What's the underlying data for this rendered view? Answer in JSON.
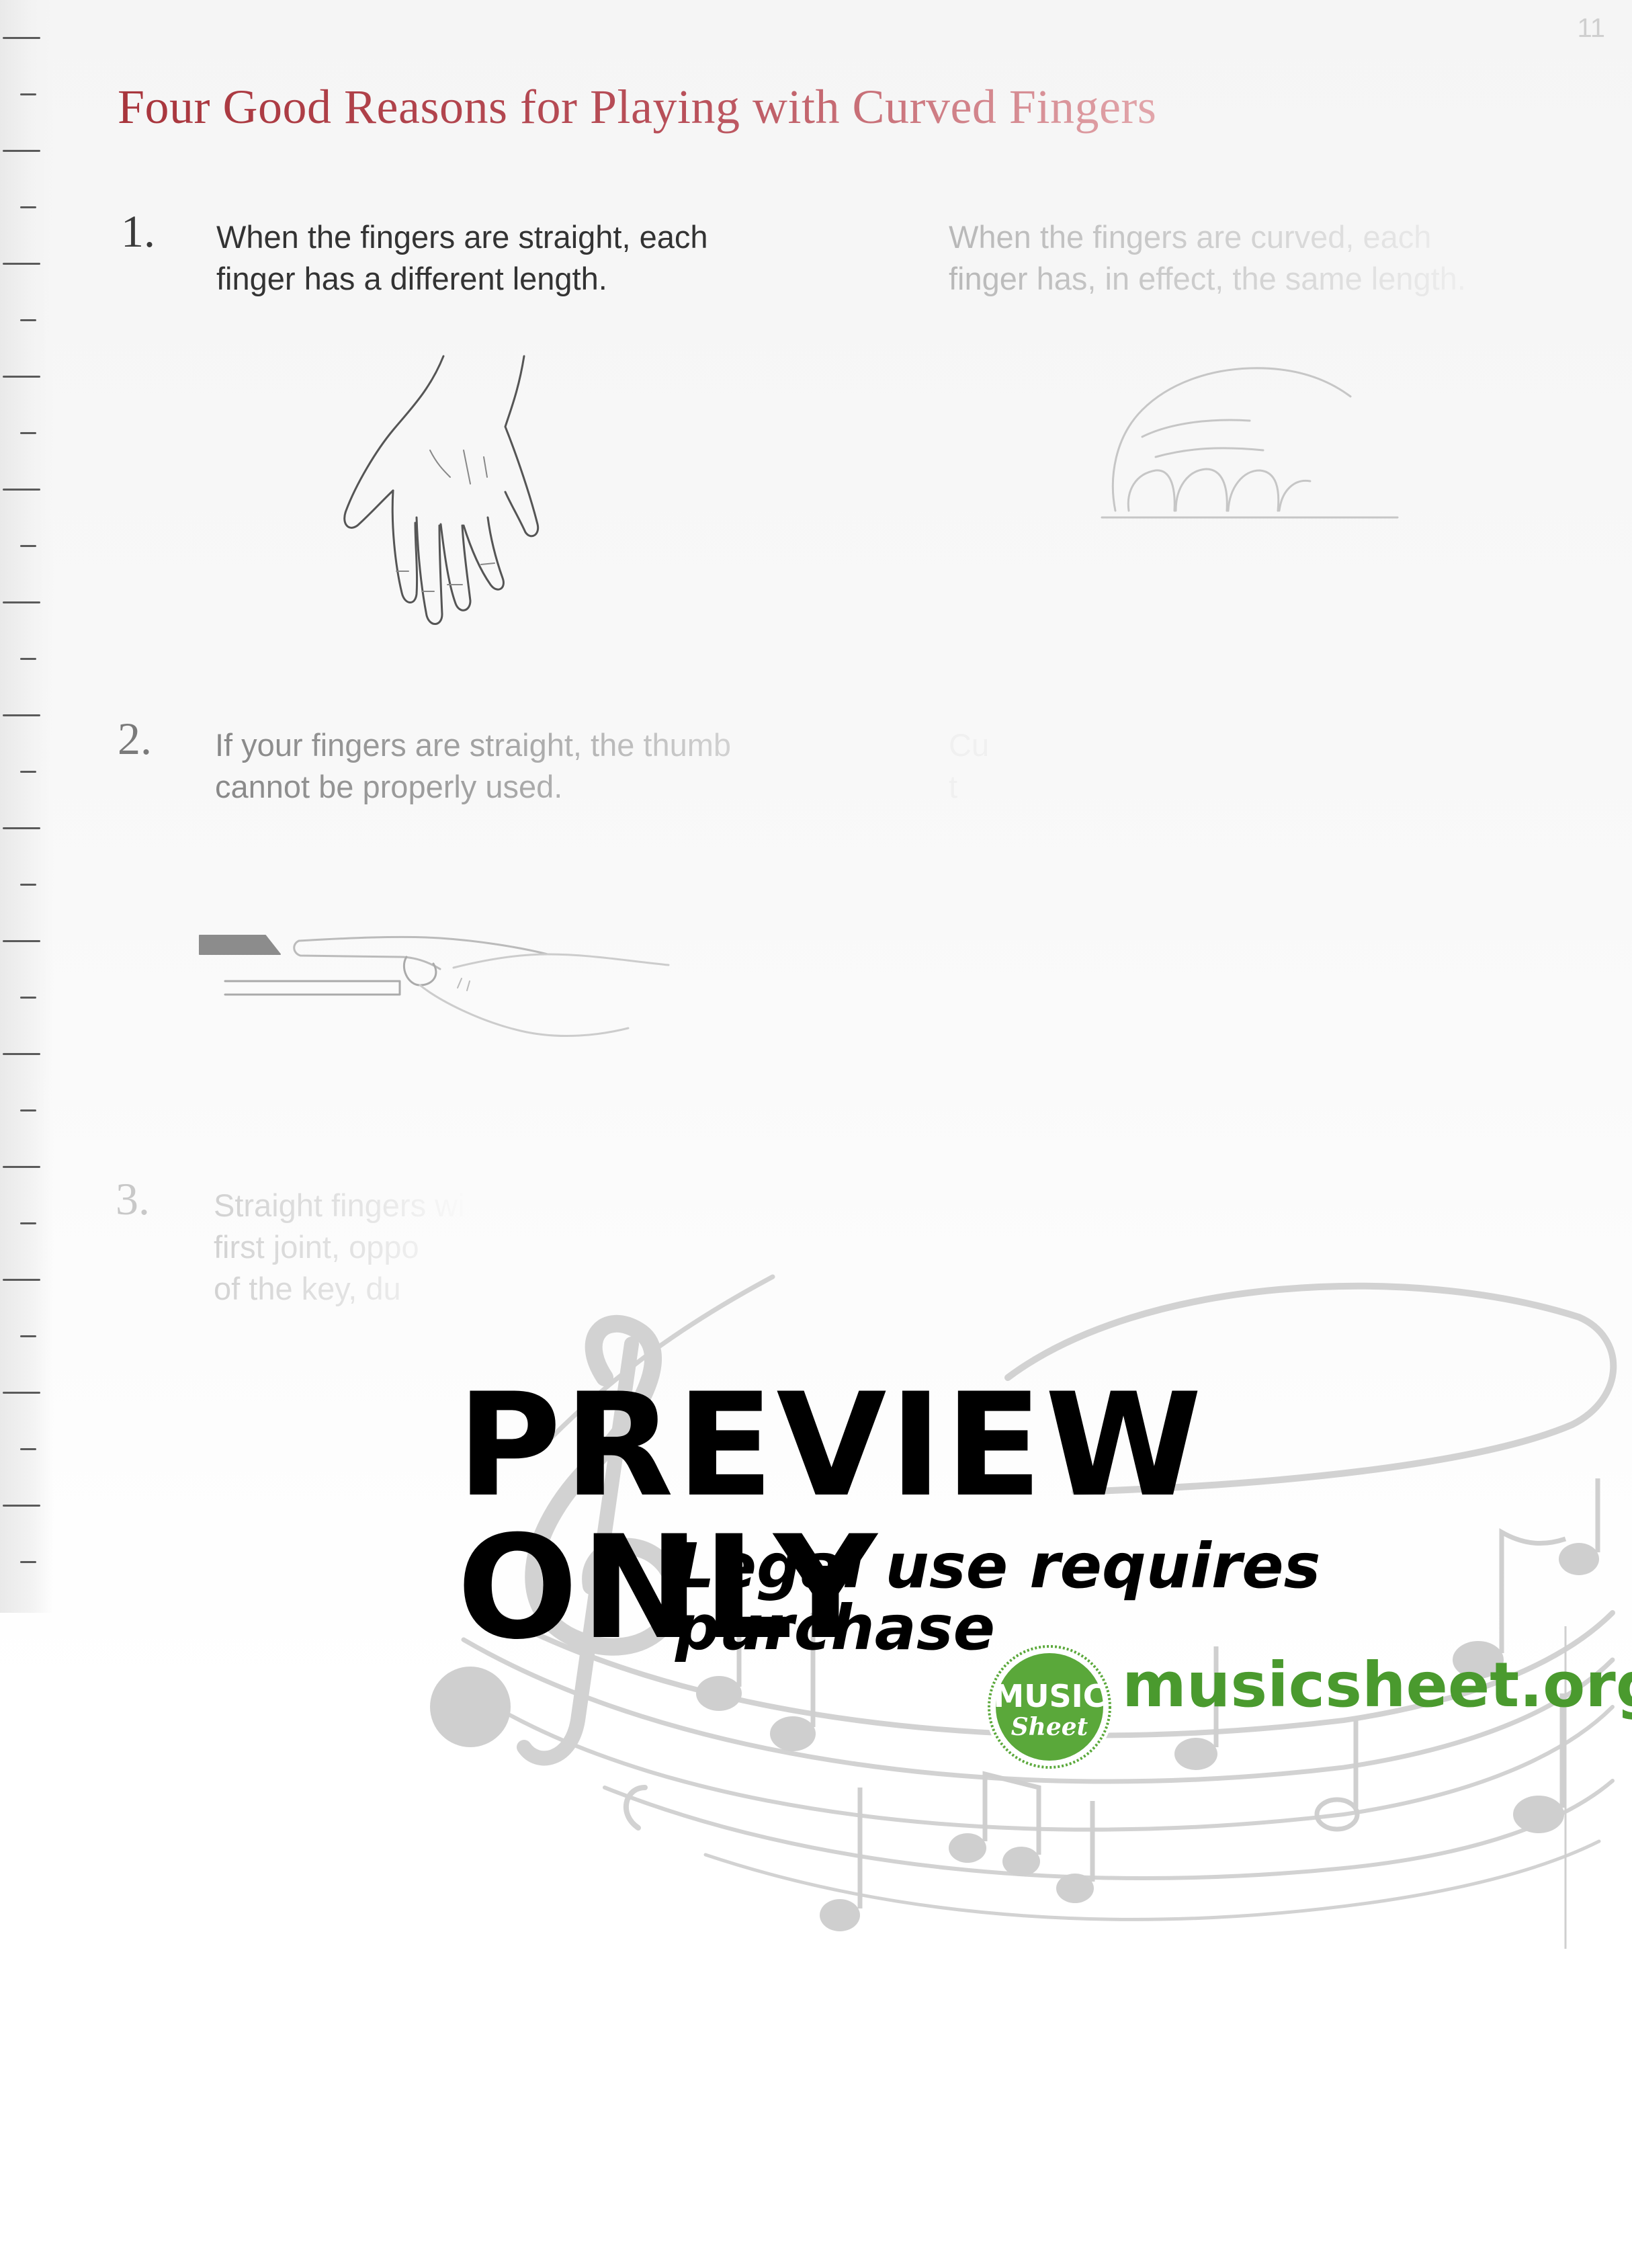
{
  "page_number": "11",
  "title": "Four Good Reasons for Playing with Curved Fingers",
  "items": [
    {
      "number": "1.",
      "left_text": "When the fingers are straight, each\nfinger has a different length.",
      "right_text": "When the fingers are curved, each\nfinger has, in effect, the same length."
    },
    {
      "number": "2.",
      "left_text": "If your fingers are straight, the thumb\ncannot be properly used.",
      "right_text": "Cu\nt"
    },
    {
      "number": "3.",
      "left_text": "Straight fingers wi\nfirst joint, oppo\nof the key, du"
    }
  ],
  "watermark": {
    "headline": "PREVIEW ONLY",
    "subline": "Legal use requires purchase",
    "logo_top": "MUSIC",
    "logo_bottom": "Sheet",
    "site": "musicsheet.org",
    "colors": {
      "site_green": "#4a9a2e",
      "logo_green": "#5aa83a",
      "notes_gray": "#cfcfcf"
    }
  },
  "colors": {
    "title_red": "#a8353c",
    "text_dark": "#333333"
  }
}
